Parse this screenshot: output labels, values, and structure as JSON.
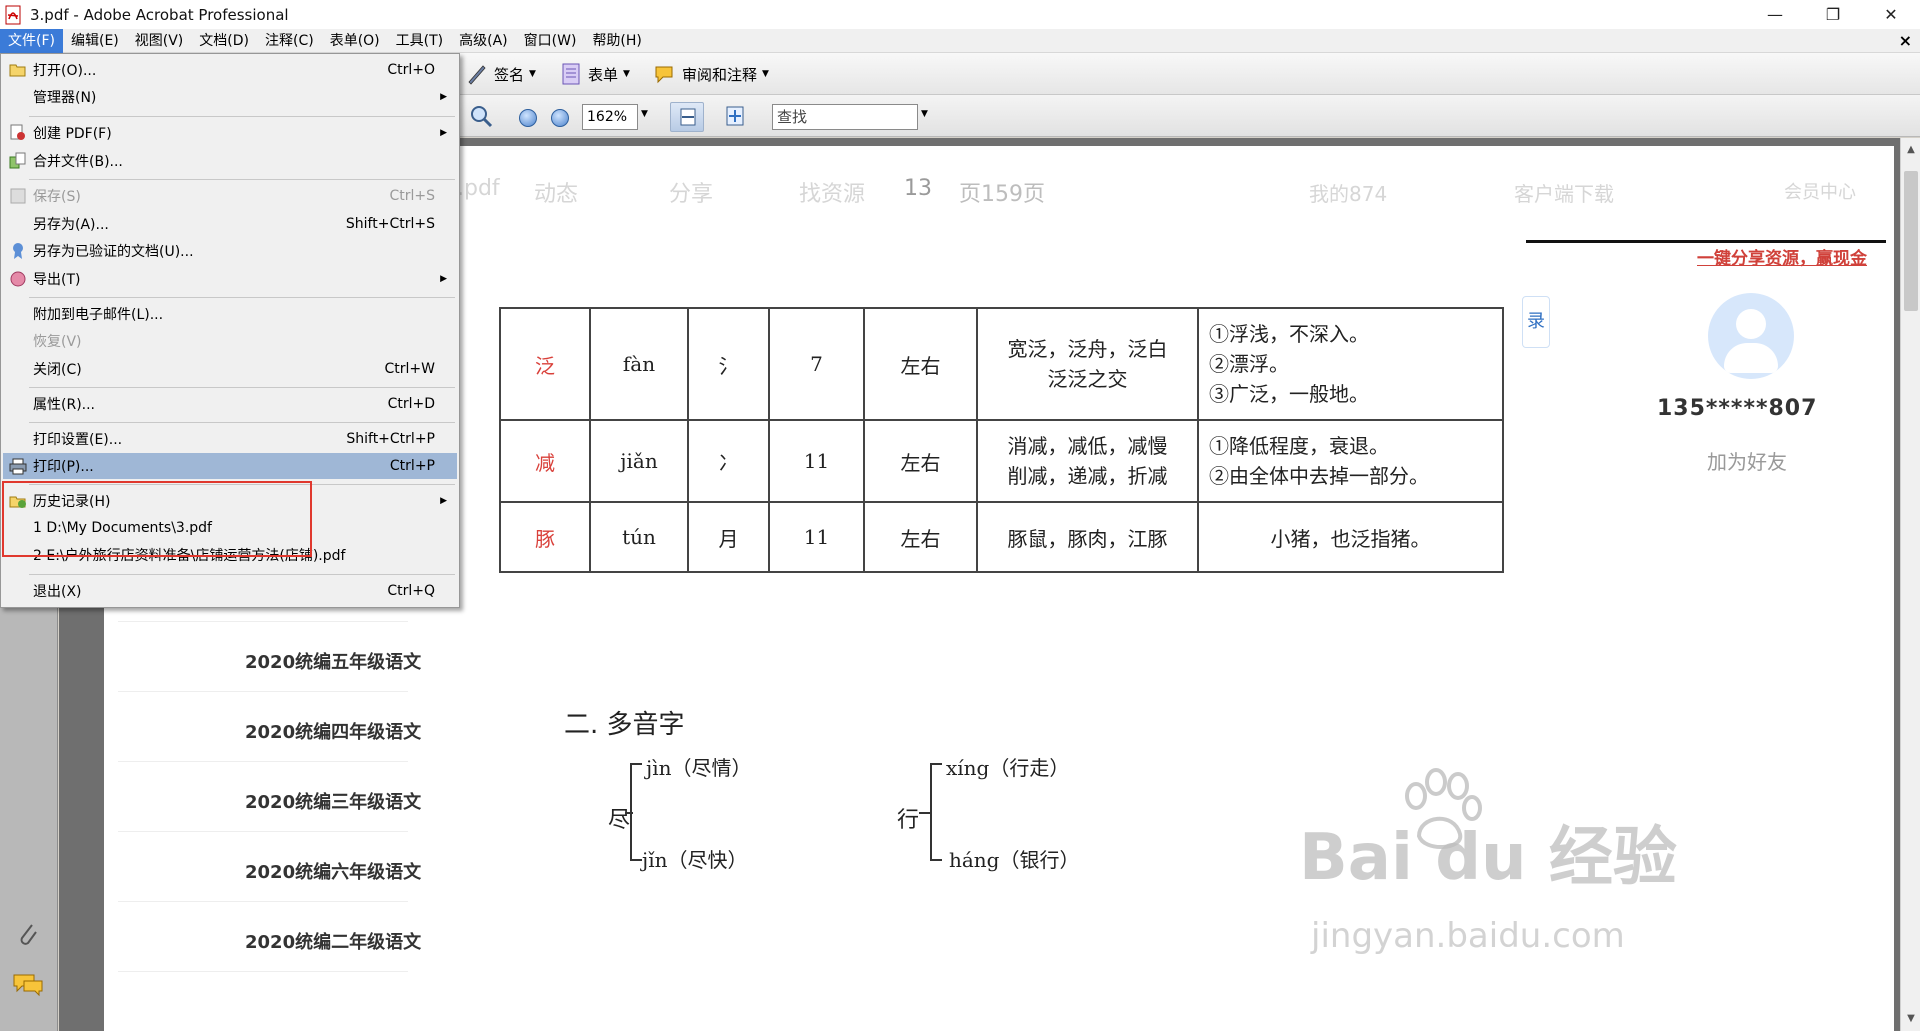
{
  "window": {
    "title": "3.pdf - Adobe Acrobat Professional",
    "controls": {
      "minimize": "—",
      "restore": "❐",
      "close": "✕"
    }
  },
  "menubar": {
    "items": [
      "文件(F)",
      "编辑(E)",
      "视图(V)",
      "文档(D)",
      "注释(C)",
      "表单(O)",
      "工具(T)",
      "高级(A)",
      "窗口(W)",
      "帮助(H)"
    ],
    "doc_close": "×"
  },
  "toolbar": {
    "sign_label": "签名",
    "forms_label": "表单",
    "review_label": "审阅和注释",
    "zoom_value": "162%",
    "find_placeholder": "查找"
  },
  "file_menu": {
    "items": [
      {
        "label": "打开(O)...",
        "shortcut": "Ctrl+O",
        "icon": "folder-open-icon"
      },
      {
        "label": "管理器(N)",
        "shortcut": "",
        "submenu": true
      },
      {
        "label": "创建 PDF(F)",
        "shortcut": "",
        "submenu": true,
        "icon": "create-pdf-icon"
      },
      {
        "label": "合并文件(B)...",
        "shortcut": "",
        "icon": "combine-files-icon"
      },
      {
        "label": "保存(S)",
        "shortcut": "Ctrl+S",
        "disabled": true,
        "icon": "save-icon"
      },
      {
        "label": "另存为(A)...",
        "shortcut": "Shift+Ctrl+S"
      },
      {
        "label": "另存为已验证的文档(U)...",
        "shortcut": "",
        "icon": "certified-document-icon"
      },
      {
        "label": "导出(T)",
        "shortcut": "",
        "submenu": true,
        "icon": "export-icon"
      },
      {
        "label": "附加到电子邮件(L)...",
        "shortcut": ""
      },
      {
        "label": "恢复(V)",
        "shortcut": "",
        "disabled": true
      },
      {
        "label": "关闭(C)",
        "shortcut": "Ctrl+W"
      },
      {
        "label": "属性(R)...",
        "shortcut": "Ctrl+D"
      },
      {
        "label": "打印设置(E)...",
        "shortcut": "Shift+Ctrl+P"
      },
      {
        "label": "打印(P)...",
        "shortcut": "Ctrl+P",
        "highlight": true,
        "icon": "printer-icon"
      },
      {
        "label": "历史记录(H)",
        "shortcut": "",
        "submenu": true,
        "icon": "history-icon"
      },
      {
        "label": "1 D:\\My Documents\\3.pdf",
        "shortcut": ""
      },
      {
        "label": "2 E:\\户外旅行店资料准备\\店铺运营方法(店铺).pdf",
        "shortcut": ""
      },
      {
        "label": "退出(X)",
        "shortcut": "Ctrl+Q"
      }
    ]
  },
  "page": {
    "faded_header": [
      ".pdf",
      "动态",
      "分享",
      "找资源",
      "13",
      "页159页",
      "我的874",
      "客户端下载",
      "会员中心"
    ],
    "share_link": "一键分享资源，赢现金",
    "user_id": "135*****807",
    "add_friend": "加为好友",
    "side_tab": "录",
    "char_table": [
      [
        "泛",
        "fàn",
        "氵",
        "7",
        "左右",
        "宽泛，泛舟，泛白\n泛泛之交",
        "①浮浅，不深入。\n②漂浮。\n③广泛，一般地。"
      ],
      [
        "减",
        "jiǎn",
        "冫",
        "11",
        "左右",
        "消减，减低，减慢\n削减，递减，折减",
        "①降低程度，衰退。\n②由全体中去掉一部分。"
      ],
      [
        "豚",
        "tún",
        "月",
        "11",
        "左右",
        "豚鼠，豚肉，江豚",
        "小猪，也泛指猪。"
      ]
    ],
    "doc_list": [
      "2020统编五年级语文",
      "2020统编四年级语文",
      "2020统编三年级语文",
      "2020统编六年级语文",
      "2020统编二年级语文"
    ],
    "section_title": "二. 多音字",
    "polyphones": [
      {
        "char": "尽",
        "readings": [
          "jìn（尽情）",
          "jǐn（尽快）"
        ]
      },
      {
        "char": "行",
        "readings": [
          "xíng（行走）",
          "háng（银行）"
        ]
      }
    ],
    "watermark": "Bai du 经验",
    "watermark_sub": "jingyan.baidu.com"
  }
}
